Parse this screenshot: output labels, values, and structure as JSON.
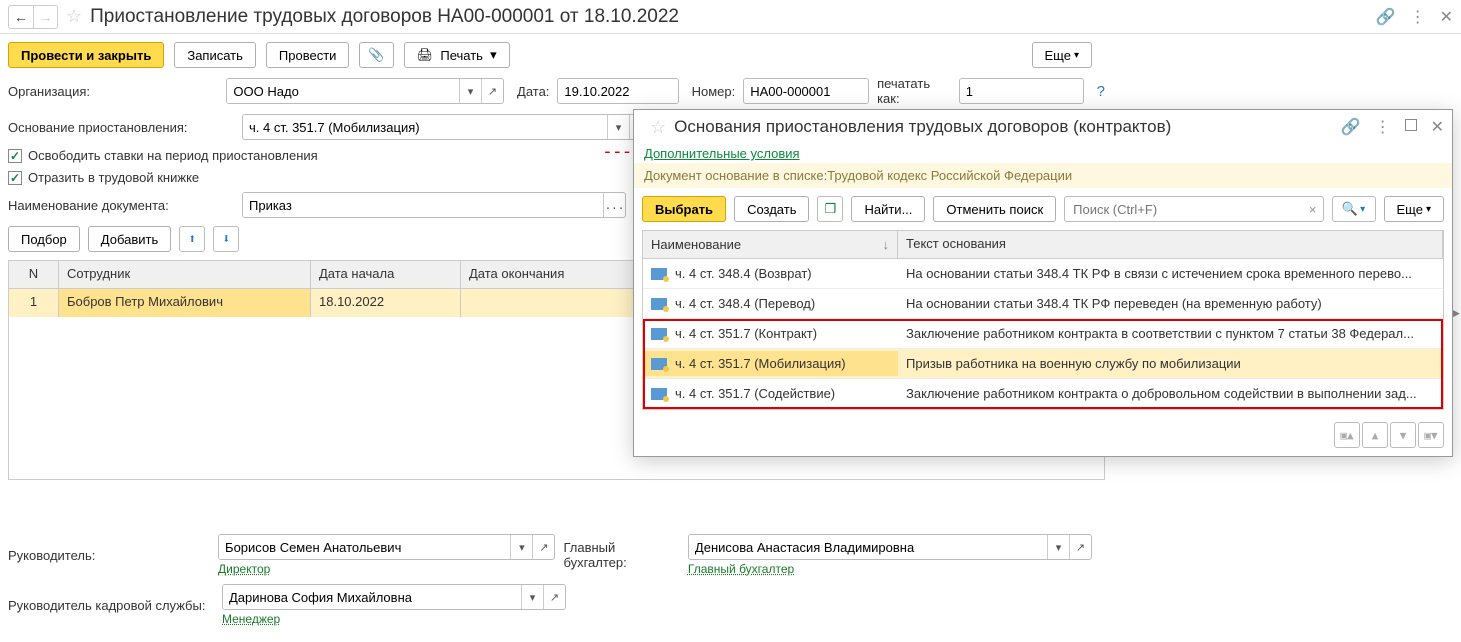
{
  "main": {
    "title": "Приостановление трудовых договоров НА00-000001 от 18.10.2022",
    "buttons": {
      "save_close": "Провести и закрыть",
      "write": "Записать",
      "post": "Провести",
      "print": "Печать",
      "more": "Еще"
    },
    "fields": {
      "org_label": "Организация:",
      "org_value": "ООО Надо",
      "date_label": "Дата:",
      "date_value": "19.10.2022",
      "number_label": "Номер:",
      "number_value": "НА00-000001",
      "print_as_label": "печатать как:",
      "print_as_value": "1",
      "basis_label": "Основание приостановления:",
      "basis_value": "ч. 4 ст. 351.7 (Мобилизация)",
      "check1": "Освободить ставки на период приостановления",
      "check2": "Отразить в трудовой книжке",
      "docname_label": "Наименование документа:",
      "docname_value": "Приказ"
    },
    "table_buttons": {
      "select": "Подбор",
      "add": "Добавить"
    },
    "table": {
      "headers": {
        "n": "N",
        "emp": "Сотрудник",
        "start": "Дата начала",
        "end": "Дата окончания"
      },
      "rows": [
        {
          "n": "1",
          "emp": "Бобров Петр Михайлович",
          "start": "18.10.2022",
          "end": ""
        }
      ]
    },
    "footer": {
      "mgr_label": "Руководитель:",
      "mgr_value": "Борисов Семен Анатольевич",
      "mgr_pos": "Директор",
      "acct_label": "Главный бухгалтер:",
      "acct_value": "Денисова Анастасия Владимировна",
      "acct_pos": "Главный бухгалтер",
      "hr_label": "Руководитель кадровой службы:",
      "hr_value": "Даринова София Михайловна",
      "hr_pos": "Менеджер"
    }
  },
  "popup": {
    "title": "Основания приостановления трудовых договоров (контрактов)",
    "additional": "Дополнительные условия",
    "info": "Документ основание в списке:Трудовой кодекс Российской Федерации",
    "buttons": {
      "choose": "Выбрать",
      "create": "Создать",
      "find": "Найти...",
      "cancel_find": "Отменить поиск",
      "more": "Еще"
    },
    "search_placeholder": "Поиск (Ctrl+F)",
    "headers": {
      "name": "Наименование",
      "text": "Текст основания"
    },
    "rows": [
      {
        "name": "ч. 4 ст. 348.4 (Возврат)",
        "text": "На основании статьи 348.4 ТК РФ в связи с истечением срока временного перево...",
        "highlighted": false
      },
      {
        "name": "ч. 4 ст. 348.4 (Перевод)",
        "text": "На основании статьи 348.4 ТК РФ переведен (на временную работу)",
        "highlighted": false
      },
      {
        "name": "ч. 4 ст. 351.7 (Контракт)",
        "text": "Заключение работником контракта в соответствии с пунктом 7 статьи 38 Федерал...",
        "highlighted": true
      },
      {
        "name": "ч. 4 ст. 351.7 (Мобилизация)",
        "text": "Призыв работника на военную службу по мобилизации",
        "highlighted": true,
        "selected": true
      },
      {
        "name": "ч. 4 ст. 351.7 (Содействие)",
        "text": "Заключение работником контракта о добровольном содействии в выполнении зад...",
        "highlighted": true
      }
    ]
  }
}
